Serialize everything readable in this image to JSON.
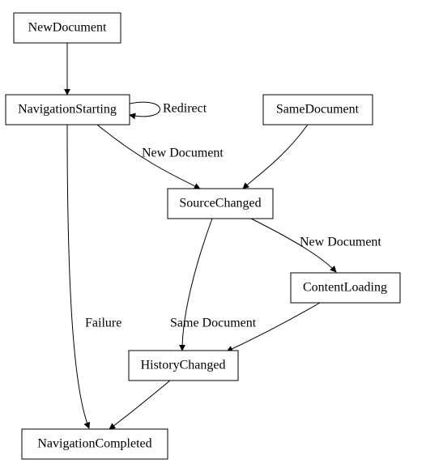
{
  "chart_data": {
    "type": "diagram",
    "title": "",
    "nodes": [
      {
        "id": "NewDocument",
        "label": "NewDocument"
      },
      {
        "id": "NavigationStarting",
        "label": "NavigationStarting"
      },
      {
        "id": "SameDocument",
        "label": "SameDocument"
      },
      {
        "id": "SourceChanged",
        "label": "SourceChanged"
      },
      {
        "id": "ContentLoading",
        "label": "ContentLoading"
      },
      {
        "id": "HistoryChanged",
        "label": "HistoryChanged"
      },
      {
        "id": "NavigationCompleted",
        "label": "NavigationCompleted"
      }
    ],
    "edges": [
      {
        "from": "NewDocument",
        "to": "NavigationStarting",
        "label": ""
      },
      {
        "from": "NavigationStarting",
        "to": "NavigationStarting",
        "label": "Redirect"
      },
      {
        "from": "NavigationStarting",
        "to": "SourceChanged",
        "label": "New Document"
      },
      {
        "from": "SameDocument",
        "to": "SourceChanged",
        "label": ""
      },
      {
        "from": "NavigationStarting",
        "to": "NavigationCompleted",
        "label": "Failure"
      },
      {
        "from": "SourceChanged",
        "to": "ContentLoading",
        "label": "New Document"
      },
      {
        "from": "SourceChanged",
        "to": "HistoryChanged",
        "label": "Same Document"
      },
      {
        "from": "ContentLoading",
        "to": "HistoryChanged",
        "label": ""
      },
      {
        "from": "HistoryChanged",
        "to": "NavigationCompleted",
        "label": ""
      }
    ]
  },
  "nodes": {
    "NewDocument": {
      "label": "NewDocument"
    },
    "NavigationStarting": {
      "label": "NavigationStarting"
    },
    "SameDocument": {
      "label": "SameDocument"
    },
    "SourceChanged": {
      "label": "SourceChanged"
    },
    "ContentLoading": {
      "label": "ContentLoading"
    },
    "HistoryChanged": {
      "label": "HistoryChanged"
    },
    "NavigationCompleted": {
      "label": "NavigationCompleted"
    }
  },
  "edgeLabels": {
    "redirect": "Redirect",
    "newDocument1": "New Document",
    "failure": "Failure",
    "newDocument2": "New Document",
    "sameDocument": "Same Document"
  }
}
